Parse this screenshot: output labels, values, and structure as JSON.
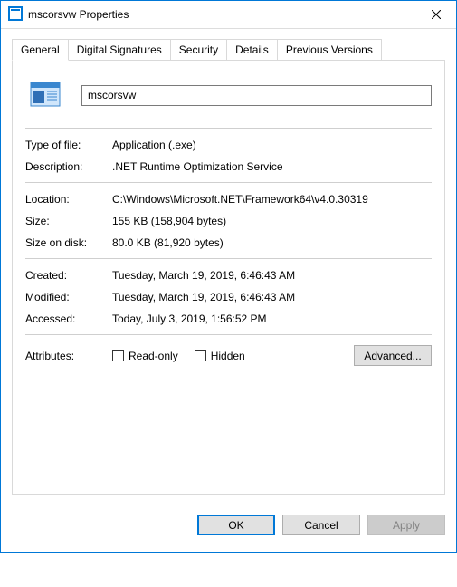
{
  "window": {
    "title": "mscorsvw Properties"
  },
  "tabs": [
    {
      "label": "General"
    },
    {
      "label": "Digital Signatures"
    },
    {
      "label": "Security"
    },
    {
      "label": "Details"
    },
    {
      "label": "Previous Versions"
    }
  ],
  "general": {
    "filename": "mscorsvw",
    "type_label": "Type of file:",
    "type_value": "Application (.exe)",
    "desc_label": "Description:",
    "desc_value": ".NET Runtime Optimization Service",
    "loc_label": "Location:",
    "loc_value": "C:\\Windows\\Microsoft.NET\\Framework64\\v4.0.30319",
    "size_label": "Size:",
    "size_value": "155 KB (158,904 bytes)",
    "disk_label": "Size on disk:",
    "disk_value": "80.0 KB (81,920 bytes)",
    "created_label": "Created:",
    "created_value": "Tuesday, March 19, 2019, 6:46:43 AM",
    "modified_label": "Modified:",
    "modified_value": "Tuesday, March 19, 2019, 6:46:43 AM",
    "accessed_label": "Accessed:",
    "accessed_value": "Today, July 3, 2019, 1:56:52 PM",
    "attributes_label": "Attributes:",
    "readonly_label": "Read-only",
    "hidden_label": "Hidden",
    "advanced_label": "Advanced..."
  },
  "footer": {
    "ok": "OK",
    "cancel": "Cancel",
    "apply": "Apply"
  }
}
